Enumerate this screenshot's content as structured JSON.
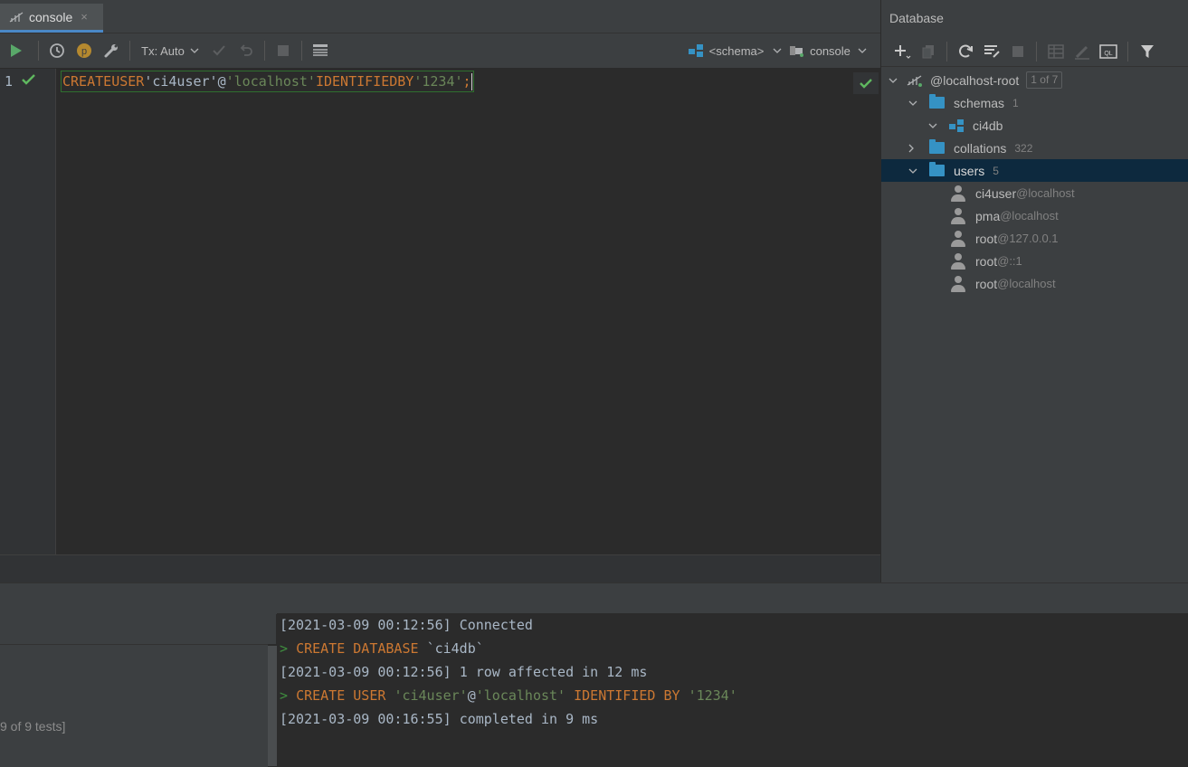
{
  "editor": {
    "tab": {
      "label": "console",
      "close": "×"
    },
    "toolbar": {
      "tx_label": "Tx: Auto",
      "schema_label": "<schema>",
      "console_label": "console"
    },
    "line_number": "1",
    "code": {
      "kw_create": "CREATE",
      "kw_user": "USER",
      "user_str": "'ci4user'",
      "at": "@",
      "host_str": "'localhost'",
      "kw_identified": "IDENTIFIED",
      "kw_by": "BY",
      "pass_str": "'1234'",
      "semicolon": ";"
    }
  },
  "database": {
    "title": "Database",
    "root": {
      "label": "@localhost-root",
      "badge": "1 of 7"
    },
    "schemas": {
      "label": "schemas",
      "count": "1"
    },
    "schema_item": {
      "label": "ci4db"
    },
    "collations": {
      "label": "collations",
      "count": "322"
    },
    "users": {
      "label": "users",
      "count": "5"
    },
    "user_list": [
      {
        "name": "ci4user",
        "host": "@localhost"
      },
      {
        "name": "pma",
        "host": "@localhost"
      },
      {
        "name": "root",
        "host": "@127.0.0.1"
      },
      {
        "name": "root",
        "host": "@::1"
      },
      {
        "name": "root",
        "host": "@localhost"
      }
    ]
  },
  "tests": {
    "summary": "9 of 9 tests]"
  },
  "output": {
    "l1_time": "[2021-03-09 00:12:56]",
    "l1_msg": "Connected",
    "l2_prompt": ">",
    "l2_kw1": "CREATE",
    "l2_kw2": "DATABASE",
    "l2_name": "`ci4db`",
    "l3_time": "[2021-03-09 00:12:56]",
    "l3_msg": "1 row affected in 12 ms",
    "l4_prompt": ">",
    "l4_kw1": "CREATE",
    "l4_kw2": "USER",
    "l4_user": "'ci4user'",
    "l4_at": "@",
    "l4_host": "'localhost'",
    "l4_kw3": "IDENTIFIED",
    "l4_kw4": "BY",
    "l4_pass": "'1234'",
    "l5_time": "[2021-03-09 00:16:55]",
    "l5_msg": "completed in 9 ms"
  },
  "colors": {
    "keyword": "#cc7832",
    "string": "#6a8759",
    "accent": "#4a88c7",
    "success": "#5fb85f",
    "selection": "#0d293e"
  },
  "icons": [
    "console-icon",
    "close-icon",
    "run-icon",
    "history-icon",
    "p-icon",
    "wrench-icon",
    "chevron-down-icon",
    "commit-icon",
    "rollback-icon",
    "stop-icon",
    "table-icon",
    "schema-icon",
    "console-icon",
    "add-icon",
    "copy-icon",
    "refresh-icon",
    "filter-icon",
    "folder-icon",
    "user-icon",
    "check-icon"
  ]
}
